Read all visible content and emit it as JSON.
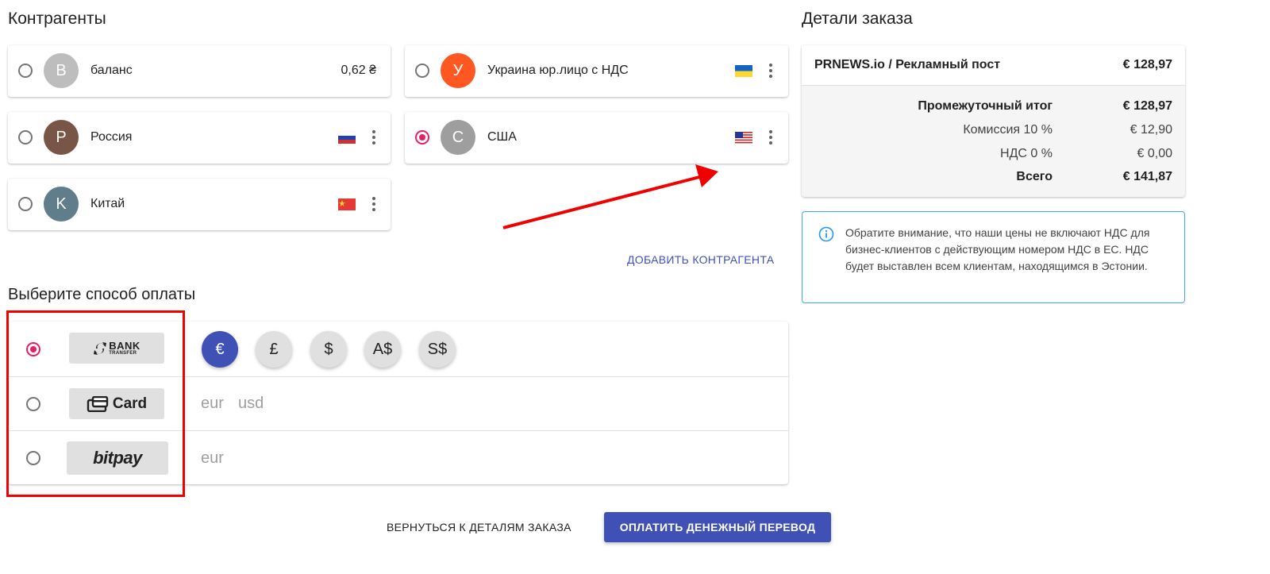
{
  "counterparties": {
    "title": "Контрагенты",
    "items": [
      {
        "letter": "B",
        "name": "баланс",
        "amount": "0,62 ₴",
        "avatar_color": "#bdbdbd",
        "selected": false
      },
      {
        "letter": "У",
        "name": "Украина юр.лицо с НДС",
        "flag": "ukraine-flag",
        "avatar_color": "#ff5722",
        "selected": false
      },
      {
        "letter": "P",
        "name": "Россия",
        "flag": "russia-flag",
        "avatar_color": "#795548",
        "selected": false
      },
      {
        "letter": "C",
        "name": "США",
        "flag": "usa-flag",
        "avatar_color": "#9e9e9e",
        "selected": true
      },
      {
        "letter": "K",
        "name": "Китай",
        "flag": "china-flag",
        "avatar_color": "#607d8b",
        "selected": false
      }
    ],
    "add_label": "ДОБАВИТЬ КОНТРАГЕНТА"
  },
  "payment": {
    "title": "Выберите способ оплаты",
    "methods": [
      {
        "name": "bank-transfer",
        "logo_main": "BANK",
        "logo_sub": "TRANSFER",
        "selected": true,
        "currencies": [
          "€",
          "£",
          "$",
          "A$",
          "S$"
        ],
        "active_currency": "€"
      },
      {
        "name": "card",
        "logo_main": "Card",
        "selected": false,
        "currencies_text": [
          "eur",
          "usd"
        ]
      },
      {
        "name": "bitpay",
        "logo_main": "bitpay",
        "selected": false,
        "currencies_text": [
          "eur"
        ]
      }
    ]
  },
  "order": {
    "title": "Детали заказа",
    "item_label": "PRNEWS.io / Рекламный пост",
    "item_price": "€ 128,97",
    "subtotal_label": "Промежуточный итог",
    "subtotal_value": "€ 128,97",
    "commission_label": "Комиссия 10 %",
    "commission_value": "€ 12,90",
    "vat_label": "НДС 0 %",
    "vat_value": "€ 0,00",
    "total_label": "Всего",
    "total_value": "€ 141,87"
  },
  "notice": {
    "text": "Обратите внимание, что наши цены не включают НДС для бизнес-клиентов с действующим номером НДС в ЕС. НДС будет выставлен всем клиентам, находящимся в Эстонии.",
    "icon": "info-icon",
    "border_color": "#42a5f5"
  },
  "actions": {
    "back_label": "ВЕРНУТЬСЯ К ДЕТАЛЯМ ЗАКАЗА",
    "pay_label": "ОПЛАТИТЬ ДЕНЕЖНЫЙ ПЕРЕВОД"
  },
  "colors": {
    "accent": "#3f51b5",
    "radio_selected": "#e91e63",
    "annotation": "#f00000"
  }
}
